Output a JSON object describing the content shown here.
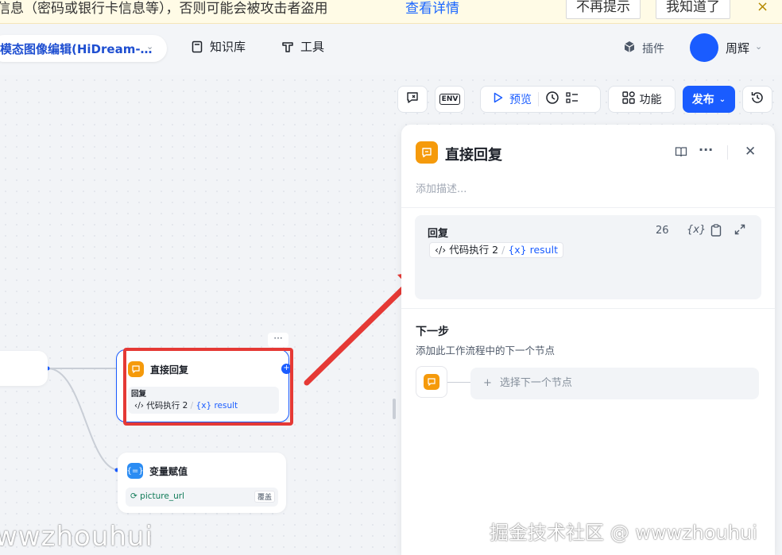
{
  "banner": {
    "text": "信息（密码或银行卡信息等），否则可能会被攻击者盗用",
    "link": "查看详情",
    "btn_no_remind": "不再提示",
    "btn_know": "我知道了",
    "close": "×"
  },
  "topbar": {
    "app_title": "模态图像编辑(HiDream-…",
    "nav": [
      {
        "label": "知识库",
        "icon": "book-icon"
      },
      {
        "label": "工具",
        "icon": "tool-icon"
      }
    ],
    "plugin_label": "插件",
    "user_name": "周辉"
  },
  "toolbar": {
    "env_label": "ENV",
    "preview_label": "预览",
    "feature_label": "功能",
    "publish_label": "发布"
  },
  "canvas": {
    "node_reply": {
      "title": "直接回复",
      "body_label": "回复",
      "chip_source": "代码执行 2",
      "chip_var": "{x} result"
    },
    "node_assign": {
      "title": "变量赋值",
      "var": "picture_url",
      "badge": "覆盖"
    },
    "more": "···"
  },
  "panel": {
    "title": "直接回复",
    "description_placeholder": "添加描述...",
    "reply_label": "回复",
    "reply_count": "26",
    "reply_chip_source": "代码执行 2",
    "reply_chip_var": "{x} result",
    "var_icon_text": "{x}",
    "next_label": "下一步",
    "next_desc": "添加此工作流程中的下一个节点",
    "next_select": "选择下一个节点"
  },
  "colors": {
    "accent": "#1a5cff",
    "reply_icon": "#f59a0b",
    "assign_icon": "#2b8cf3",
    "annotation": "#e53935"
  },
  "watermark": {
    "left": "wwzhouhui",
    "right": "掘金技术社区 @ wwwzhouhui"
  }
}
